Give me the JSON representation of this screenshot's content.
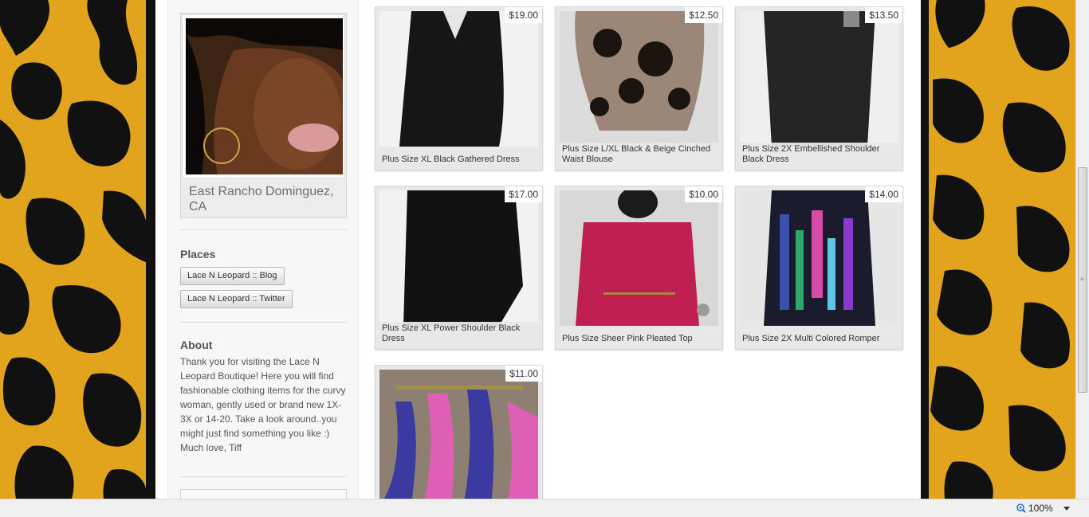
{
  "profile": {
    "location": "East Rancho Dominguez, CA"
  },
  "places": {
    "heading": "Places",
    "links": [
      "Lace N Leopard :: Blog",
      "Lace N Leopard :: Twitter"
    ]
  },
  "about": {
    "heading": "About",
    "text": "Thank you for visiting the Lace N Leopard Boutique! Here you will find fashionable clothing items for the curvy woman, gently used or brand new 1X-3X or 14-20. Take a look around..you might just find something you like :) Much love, Tiff"
  },
  "items": [
    {
      "price": "$19.00",
      "title": "Plus Size XL Black Gathered Dress"
    },
    {
      "price": "$12.50",
      "title": "Plus Size L/XL Black & Beige Cinched Waist Blouse"
    },
    {
      "price": "$13.50",
      "title": "Plus Size 2X Embellished Shoulder Black Dress"
    },
    {
      "price": "$17.00",
      "title": "Plus Size XL Power Shoulder Black Dress"
    },
    {
      "price": "$10.00",
      "title": "Plus Size Sheer Pink Pleated Top"
    },
    {
      "price": "$14.00",
      "title": "Plus Size 2X Multi Colored Romper"
    },
    {
      "price": "$11.00",
      "title": ""
    }
  ],
  "statusbar": {
    "zoom": "100%"
  },
  "colors": {
    "leopard_gold": "#e2a41d",
    "leopard_black": "#111111"
  },
  "icons": {
    "zoom": "zoom-icon",
    "dropdown": "chevron-down-icon"
  }
}
